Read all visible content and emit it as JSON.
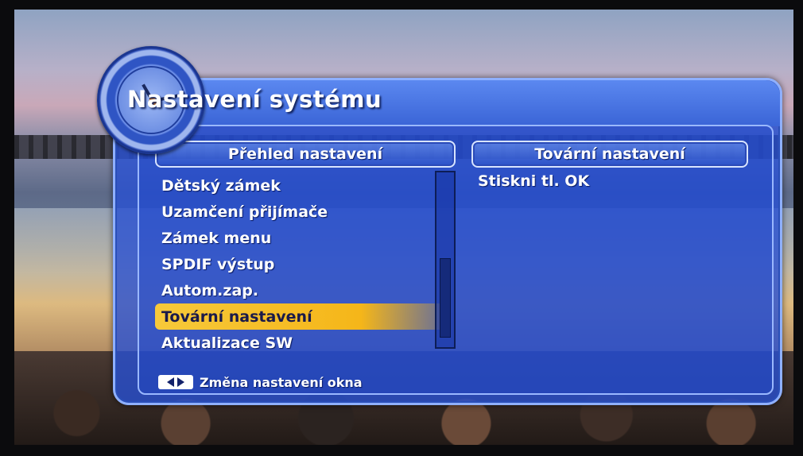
{
  "window": {
    "title": "Nastavení systému",
    "icon": "clock-icon"
  },
  "left_panel": {
    "header": "Přehled nastavení",
    "items": [
      {
        "label": "Dětský zámek",
        "selected": false
      },
      {
        "label": "Uzamčení přijímače",
        "selected": false
      },
      {
        "label": "Zámek menu",
        "selected": false
      },
      {
        "label": "SPDIF výstup",
        "selected": false
      },
      {
        "label": "Autom.zap.",
        "selected": false
      },
      {
        "label": "Tovární nastavení",
        "selected": true
      },
      {
        "label": "Aktualizace SW",
        "selected": false
      }
    ]
  },
  "right_panel": {
    "header": "Tovární nastavení",
    "text": "Stiskni tl. OK"
  },
  "footer": {
    "icon": "left-right-arrows-icon",
    "hint": "Změna nastavení okna"
  },
  "colors": {
    "osd_blue": "#2850d2",
    "highlight": "#f5b619",
    "text": "#ffffff"
  }
}
